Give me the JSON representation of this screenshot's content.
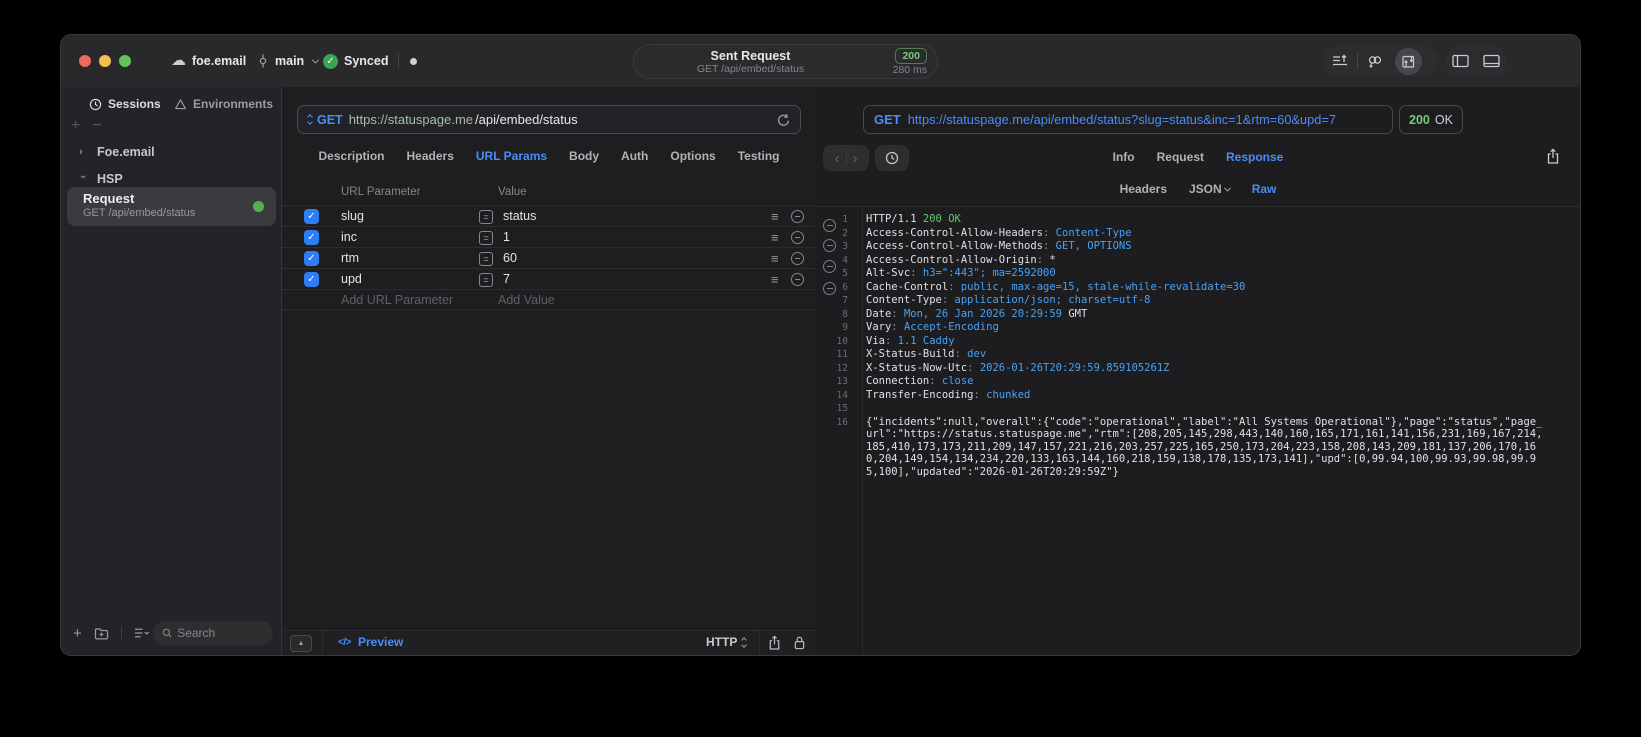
{
  "titlebar": {
    "project": "foe.email",
    "branch": "main",
    "sync_label": "Synced",
    "request_pill": {
      "title": "Sent Request",
      "subtitle": "GET /api/embed/status",
      "status_code": "200",
      "duration": "280 ms"
    }
  },
  "sidebar": {
    "tabs": [
      {
        "label": "Sessions",
        "active": true
      },
      {
        "label": "Environments",
        "active": false
      }
    ],
    "tree": [
      {
        "label": "Foe.email",
        "expanded": false
      },
      {
        "label": "HSP",
        "expanded": true
      }
    ],
    "request_item": {
      "title": "Request",
      "subtitle": "GET /api/embed/status",
      "selected": true
    },
    "search_placeholder": "Search"
  },
  "request_editor": {
    "method": "GET",
    "url_host": "https://statuspage.me",
    "url_path": "/api/embed/status",
    "tabs": [
      "Description",
      "Headers",
      "URL Params",
      "Body",
      "Auth",
      "Options",
      "Testing"
    ],
    "active_tab": "URL Params",
    "params": {
      "columns": [
        "URL Parameter",
        "Value"
      ],
      "rows": [
        {
          "enabled": true,
          "name": "slug",
          "value": "status"
        },
        {
          "enabled": true,
          "name": "inc",
          "value": "1"
        },
        {
          "enabled": true,
          "name": "rtm",
          "value": "60"
        },
        {
          "enabled": true,
          "name": "upd",
          "value": "7"
        }
      ],
      "add_name_placeholder": "Add URL Parameter",
      "add_value_placeholder": "Add Value"
    },
    "footer": {
      "preview_icon": "</>",
      "preview_label": "Preview",
      "protocol_selector": "HTTP"
    }
  },
  "response_viewer": {
    "method": "GET",
    "url": "https://statuspage.me/api/embed/status?slug=status&inc=1&rtm=60&upd=7",
    "status_code": "200",
    "status_text": "OK",
    "tabs": [
      "Info",
      "Request",
      "Response"
    ],
    "active_tab": "Response",
    "subtabs": [
      {
        "label": "Headers"
      },
      {
        "label": "JSON",
        "dropdown": true
      },
      {
        "label": "Raw"
      }
    ],
    "active_subtab": "Raw",
    "code_lines": [
      {
        "n": "1",
        "parts": [
          {
            "c": "p",
            "t": "HTTP/1.1 "
          },
          {
            "c": "s",
            "t": "200 OK"
          }
        ]
      },
      {
        "n": "2",
        "parts": [
          {
            "c": "p",
            "t": "Access-Control-Allow-Headers"
          },
          {
            "c": "d",
            "t": ": "
          },
          {
            "c": "v",
            "t": "Content-Type"
          }
        ]
      },
      {
        "n": "3",
        "parts": [
          {
            "c": "p",
            "t": "Access-Control-Allow-Methods"
          },
          {
            "c": "d",
            "t": ": "
          },
          {
            "c": "v",
            "t": "GET, OPTIONS"
          }
        ]
      },
      {
        "n": "4",
        "parts": [
          {
            "c": "p",
            "t": "Access-Control-Allow-Origin"
          },
          {
            "c": "d",
            "t": ": "
          },
          {
            "c": "p",
            "t": "*"
          }
        ]
      },
      {
        "n": "5",
        "parts": [
          {
            "c": "p",
            "t": "Alt-Svc"
          },
          {
            "c": "d",
            "t": ": "
          },
          {
            "c": "v",
            "t": "h3=\":443\"; ma=2592000"
          }
        ]
      },
      {
        "n": "6",
        "parts": [
          {
            "c": "p",
            "t": "Cache-Control"
          },
          {
            "c": "d",
            "t": ": "
          },
          {
            "c": "v",
            "t": "public, max-age=15, stale-while-revalidate=30"
          }
        ]
      },
      {
        "n": "7",
        "parts": [
          {
            "c": "p",
            "t": "Content-Type"
          },
          {
            "c": "d",
            "t": ": "
          },
          {
            "c": "v",
            "t": "application/json; charset=utf-8"
          }
        ]
      },
      {
        "n": "8",
        "parts": [
          {
            "c": "p",
            "t": "Date"
          },
          {
            "c": "d",
            "t": ": "
          },
          {
            "c": "v",
            "t": "Mon, 26 Jan 2026 20:29:59"
          },
          {
            "c": "p",
            "t": " GMT"
          }
        ]
      },
      {
        "n": "9",
        "parts": [
          {
            "c": "p",
            "t": "Vary"
          },
          {
            "c": "d",
            "t": ": "
          },
          {
            "c": "v",
            "t": "Accept-Encoding"
          }
        ]
      },
      {
        "n": "10",
        "parts": [
          {
            "c": "p",
            "t": "Via"
          },
          {
            "c": "d",
            "t": ": "
          },
          {
            "c": "v",
            "t": "1.1 Caddy"
          }
        ]
      },
      {
        "n": "11",
        "parts": [
          {
            "c": "p",
            "t": "X-Status-Build"
          },
          {
            "c": "d",
            "t": ": "
          },
          {
            "c": "v",
            "t": "dev"
          }
        ]
      },
      {
        "n": "12",
        "parts": [
          {
            "c": "p",
            "t": "X-Status-Now-Utc"
          },
          {
            "c": "d",
            "t": ": "
          },
          {
            "c": "v",
            "t": "2026-01-26T20:29:59.859105261Z"
          }
        ]
      },
      {
        "n": "13",
        "parts": [
          {
            "c": "p",
            "t": "Connection"
          },
          {
            "c": "d",
            "t": ": "
          },
          {
            "c": "v",
            "t": "close"
          }
        ]
      },
      {
        "n": "14",
        "parts": [
          {
            "c": "p",
            "t": "Transfer-Encoding"
          },
          {
            "c": "d",
            "t": ": "
          },
          {
            "c": "v",
            "t": "chunked"
          }
        ]
      },
      {
        "n": "15",
        "parts": []
      },
      {
        "n": "16",
        "parts": [
          {
            "c": "p",
            "t": "{\"incidents\":null,\"overall\":{\"code\":\"operational\",\"label\":\"All Systems Operational\"},\"page\":\"status\",\"page_url\":\"https://status.statuspage.me\",\"rtm\":[208,205,145,298,443,140,160,165,171,161,141,156,231,169,167,214,185,410,173,173,211,209,147,157,221,216,203,257,225,165,250,173,204,223,158,208,143,209,181,137,206,170,160,204,149,154,134,234,220,133,163,144,160,218,159,138,178,135,173,141],\"upd\":[0,99.94,100,99.93,99.98,99.95,100],\"updated\":\"2026-01-26T20:29:59Z\"}"
          }
        ]
      }
    ]
  },
  "colors": {
    "accent_blue": "#4a8df8",
    "success_green": "#62c96a",
    "checkbox_blue": "#2e7df6",
    "status_dot_green": "#55b054",
    "traffic_red": "#ec6a5e",
    "traffic_yellow": "#f4bf4f",
    "traffic_green": "#61c454"
  }
}
